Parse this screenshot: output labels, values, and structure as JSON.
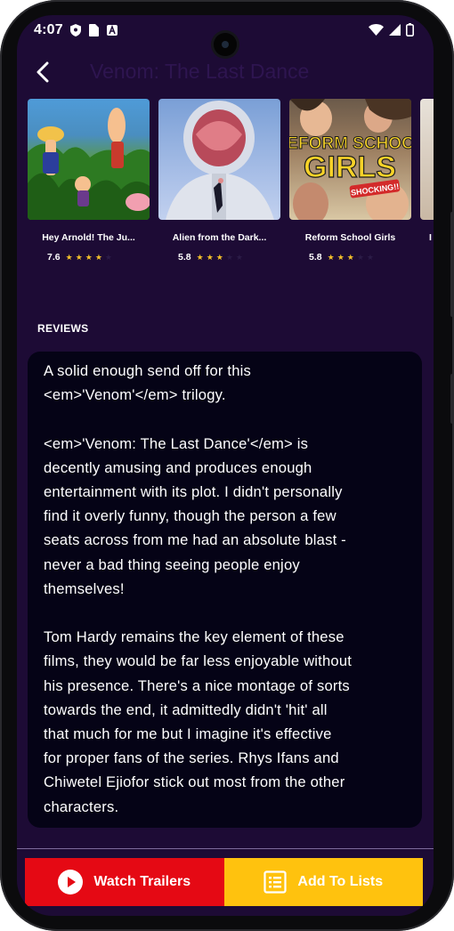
{
  "status_bar": {
    "time": "4:07"
  },
  "app_bar": {
    "title": "Venom: The Last Dance"
  },
  "similar": [
    {
      "title": "Hey Arnold! The Ju...",
      "rating": "7.6",
      "stars": 4
    },
    {
      "title": "Alien from the Dark...",
      "rating": "5.8",
      "stars": 3
    },
    {
      "title": "Reform School Girls",
      "rating": "5.8",
      "stars": 3
    },
    {
      "title": "I",
      "rating": "",
      "stars": 0
    }
  ],
  "posters": {
    "reform_school_girls": {
      "line1": "REFORM SCHOOL",
      "line2": "GIRLS",
      "badge": "SHOCKING!!"
    }
  },
  "reviews": {
    "label": "REVIEWS",
    "text": "A solid enough send off for this\n<em>'Venom'</em> trilogy.\n\n<em>'Venom: The Last Dance'</em> is\ndecently amusing and produces enough\nentertainment with its plot. I didn't personally\nfind it overly funny, though the person a few\nseats across from me had an absolute blast -\nnever a bad thing seeing people enjoy\nthemselves!\n\nTom Hardy remains the key element of these\nfilms, they would be far less enjoyable without\nhis presence. There's a nice montage of sorts\ntowards the end, it admittedly didn't 'hit' all\nthat much for me but I imagine it's effective\nfor proper fans of the series. Rhys Ifans and\nChiwetel Ejiofor stick out most from the other\ncharacters."
  },
  "actions": {
    "watch_trailers": "Watch Trailers",
    "add_to_lists": "Add To Lists"
  },
  "colors": {
    "background": "#1d0b35",
    "review_card": "#050316",
    "trailers": "#e50914",
    "lists": "#ffc20e",
    "star": "#f4c02a"
  }
}
